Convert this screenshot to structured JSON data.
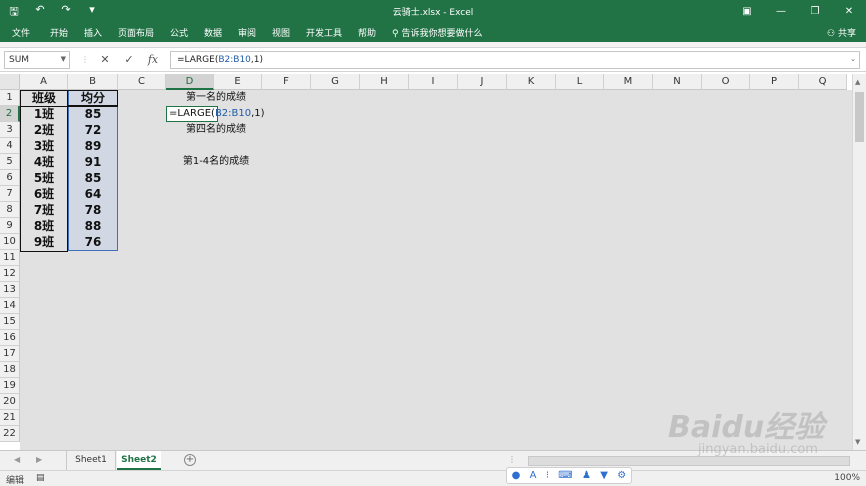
{
  "window": {
    "title": "云骑士.xlsx  -  Excel",
    "controls": [
      "▣",
      "—",
      "❐",
      "✕"
    ]
  },
  "qat": {
    "save": "🖫",
    "undo": "↶",
    "redo": "↷",
    "more": "▾"
  },
  "ribbon": {
    "tabs": [
      "文件",
      "开始",
      "插入",
      "页面布局",
      "公式",
      "数据",
      "审阅",
      "视图",
      "开发工具",
      "帮助"
    ],
    "tell_me": "告诉我你想要做什么",
    "share": "共享"
  },
  "formula_bar": {
    "name_box": "SUM",
    "cancel": "✕",
    "enter": "✓",
    "fx": "fx",
    "prefix": "=LARGE(",
    "ref": "B2:B10",
    "suffix": ",1)"
  },
  "columns": [
    "A",
    "B",
    "C",
    "D",
    "E",
    "F",
    "G",
    "H",
    "I",
    "J",
    "K",
    "L",
    "M",
    "N",
    "O",
    "P",
    "Q"
  ],
  "active_column": "D",
  "active_row": 2,
  "rows": [
    "1",
    "2",
    "3",
    "4",
    "5",
    "6",
    "7",
    "8",
    "9",
    "10",
    "11",
    "12",
    "13",
    "14",
    "15",
    "16",
    "17",
    "18",
    "19",
    "20",
    "21",
    "22"
  ],
  "table": {
    "header_class": "班级",
    "header_score": "均分",
    "classes": [
      "1班",
      "2班",
      "3班",
      "4班",
      "5班",
      "6班",
      "7班",
      "8班",
      "9班"
    ],
    "scores": [
      "85",
      "72",
      "89",
      "91",
      "85",
      "64",
      "78",
      "88",
      "76"
    ]
  },
  "labels": {
    "d1": "第一名的成绩",
    "d3": "第四名的成绩",
    "d5": "第1-4名的成绩"
  },
  "edit_cell": {
    "prefix": "=LARGE(",
    "ref": "B2:B10",
    "suffix": ",1)"
  },
  "sheets": {
    "tabs": [
      "Sheet1",
      "Sheet2"
    ],
    "active": "Sheet2",
    "add": "+"
  },
  "status": {
    "mode": "编辑",
    "zoom": "100%"
  },
  "watermark": {
    "brand": "Baidu经验",
    "url": "jingyan.baidu.com"
  },
  "colors": {
    "excel_green": "#217346",
    "selection_blue": "#3f6fb8",
    "reference_blue": "#1f5ba8"
  }
}
